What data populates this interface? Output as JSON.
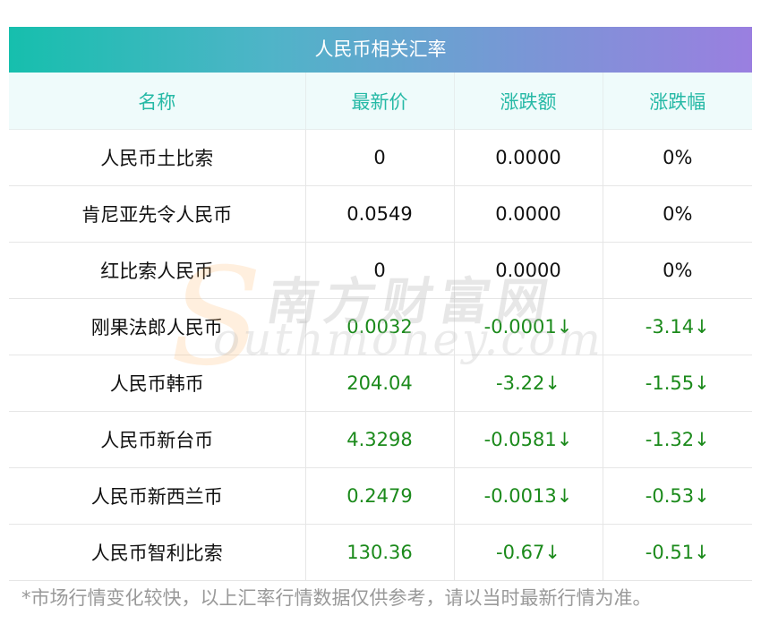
{
  "title": "人民币相关汇率",
  "headers": [
    "名称",
    "最新价",
    "涨跌额",
    "涨跌幅"
  ],
  "rows": [
    {
      "name": "人民币土比索",
      "price": "0",
      "change": "0.0000",
      "pct": "0%",
      "down": false
    },
    {
      "name": "肯尼亚先令人民币",
      "price": "0.0549",
      "change": "0.0000",
      "pct": "0%",
      "down": false
    },
    {
      "name": "红比索人民币",
      "price": "0",
      "change": "0.0000",
      "pct": "0%",
      "down": false
    },
    {
      "name": "刚果法郎人民币",
      "price": "0.0032",
      "change": "-0.0001↓",
      "pct": "-3.14↓",
      "down": true
    },
    {
      "name": "人民币韩币",
      "price": "204.04",
      "change": "-3.22↓",
      "pct": "-1.55↓",
      "down": true
    },
    {
      "name": "人民币新台币",
      "price": "4.3298",
      "change": "-0.0581↓",
      "pct": "-1.32↓",
      "down": true
    },
    {
      "name": "人民币新西兰币",
      "price": "0.2479",
      "change": "-0.0013↓",
      "pct": "-0.53↓",
      "down": true
    },
    {
      "name": "人民币智利比索",
      "price": "130.36",
      "change": "-0.67↓",
      "pct": "-0.51↓",
      "down": true
    }
  ],
  "watermark": {
    "zh": "南方财富网",
    "en": "outhmoney.com",
    "s": "S"
  },
  "note": "*市场行情变化较快，以上汇率行情数据仅供参考，请以当时最新行情为准。",
  "colors": {
    "header_text": "#26b9a6",
    "down": "#1b8a1b",
    "gradient_start": "#16bfad",
    "gradient_end": "#9a7fe0"
  }
}
